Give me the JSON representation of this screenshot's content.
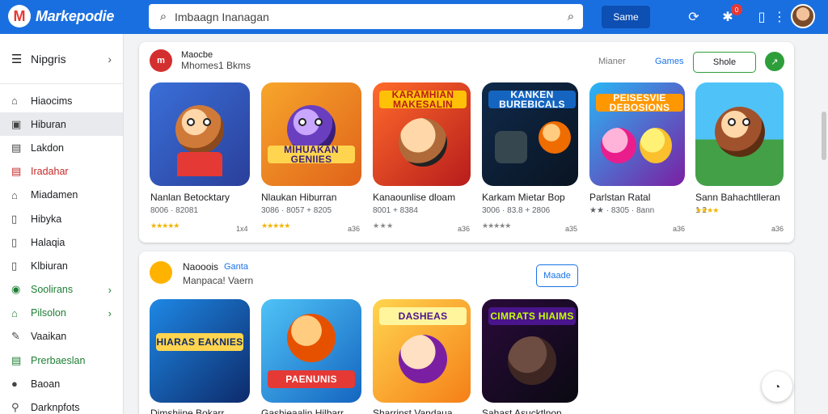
{
  "app": {
    "brand": "Markepodie",
    "logo_letter": "M"
  },
  "search": {
    "value": "Imbaagn Inanagan",
    "button_label": "Same"
  },
  "header_icons": {
    "notification_count": "0"
  },
  "sidebar": {
    "head_label": "Nipgris",
    "items": [
      {
        "label": "Hiaocims",
        "icon": "home-icon"
      },
      {
        "label": "Hiburan",
        "icon": "id-card-icon"
      },
      {
        "label": "Lakdon",
        "icon": "calendar-icon"
      },
      {
        "label": "Iradahar",
        "icon": "calendar-icon"
      },
      {
        "label": "Miadamen",
        "icon": "home-icon"
      },
      {
        "label": "Hibyka",
        "icon": "clipboard-icon"
      },
      {
        "label": "Halaqia",
        "icon": "clipboard-icon"
      },
      {
        "label": "Klbiuran",
        "icon": "clipboard-icon"
      },
      {
        "label": "Soolirans",
        "icon": "circle-dot-icon"
      },
      {
        "label": "Pilsolon",
        "icon": "home-icon"
      },
      {
        "label": "Vaaikan",
        "icon": "pen-icon"
      },
      {
        "label": "Prerbaeslan",
        "icon": "calendar-icon"
      },
      {
        "label": "Baoan",
        "icon": "circle-icon"
      },
      {
        "label": "Darknpfots",
        "icon": "pin-icon"
      }
    ]
  },
  "section1": {
    "dev_logo": "m",
    "dev_name": "Maocbe",
    "dev_sub": "Mhomes1 Bkms",
    "tab_inactive": "Mianer",
    "tab_active": "Games",
    "button_label": "Shole",
    "round_label": "↗",
    "games": [
      {
        "tile_text": "",
        "title": "Nanlan Betocktary",
        "meta": "8006 · 82081",
        "stars": "★★★★★",
        "corner": "1x4"
      },
      {
        "tile_text": "MIHUAKAN GENIIES",
        "title": "Nlaukan Hiburran",
        "meta": "3086 · 8057 + 8205",
        "stars": "★★★★★",
        "corner": "a36"
      },
      {
        "tile_text": "KARAMHIAN MAKESALIN",
        "title": "Kanaounlise dloam",
        "meta": "8001 + 8384",
        "stars": "★ ★ ★",
        "corner": "a36"
      },
      {
        "tile_text": "KANKEN BUREBICALS",
        "title": "Karkam Mietar Bop",
        "meta": "3006 · 83.8 + 2806",
        "stars": "★★★★★",
        "corner": "a35"
      },
      {
        "tile_text": "PEISESVIE DEBOSIONS",
        "title": "Parlstan Ratal",
        "meta": "★★ · 8305 · 8ann",
        "stars": "★★★★",
        "corner": "a36"
      },
      {
        "tile_text": "",
        "title": "Sann Bahachtlleran",
        "meta": "1 2",
        "stars": "★★★★",
        "corner": "a36"
      }
    ]
  },
  "section2": {
    "dev_name": "Naooois",
    "dev_tag": "Ganta",
    "dev_sub": "Manpaca! Vaern",
    "button_label": "Maade",
    "games": [
      {
        "tile_text": "HIARAS EAKNIES",
        "title": "Dimshiine Bokarr"
      },
      {
        "tile_text": "PAENUNIS",
        "title": "Gashieaalin Hilbarr"
      },
      {
        "tile_text": "DASHEAS",
        "title": "Sharrinst Vandaua"
      },
      {
        "tile_text": "CIMRATS HIAIMS",
        "title": "Sahast Asucktlnon"
      }
    ]
  },
  "float_button": {
    "icon": "chat-icon"
  }
}
